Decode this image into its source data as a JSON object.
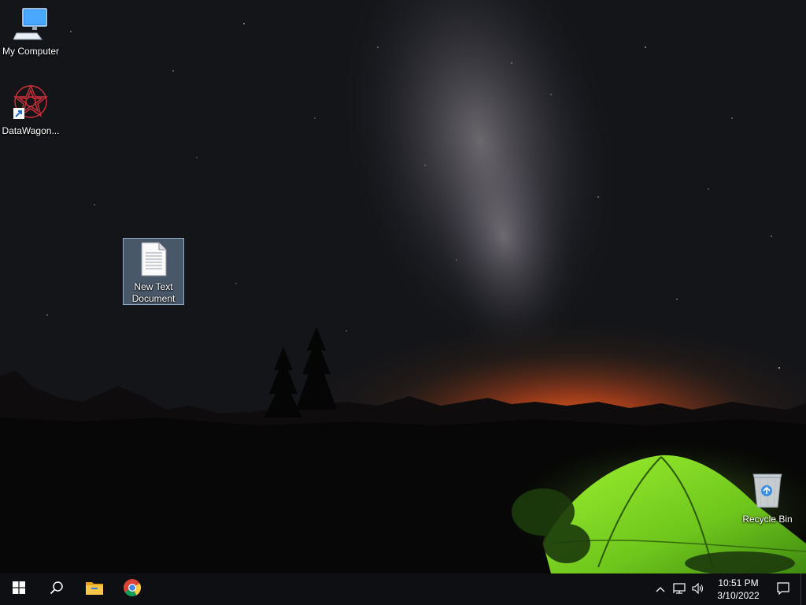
{
  "desktop": {
    "icons": [
      {
        "label": "My Computer",
        "icon": "computer-icon"
      },
      {
        "label": "DataWagon...",
        "icon": "datawagon-shortcut-icon"
      },
      {
        "label": "New Text Document",
        "icon": "text-document-icon",
        "selected": true
      },
      {
        "label": "Recycle Bin",
        "icon": "recycle-bin-icon"
      }
    ],
    "wallpaper": "night-sky-milky-way-tent"
  },
  "taskbar": {
    "start": "windows-start-icon",
    "search": "search-icon",
    "pinned": [
      "file-explorer-icon",
      "chrome-icon"
    ],
    "tray": {
      "icons": [
        "chevron-up-icon",
        "network-icon",
        "volume-icon"
      ],
      "time": "10:51 PM",
      "date": "3/10/2022",
      "notifications": "action-center-icon"
    }
  },
  "colors": {
    "taskbar_bg": "#0d0f12",
    "selection": "#8caacd",
    "tent_green": "#7ed321"
  }
}
